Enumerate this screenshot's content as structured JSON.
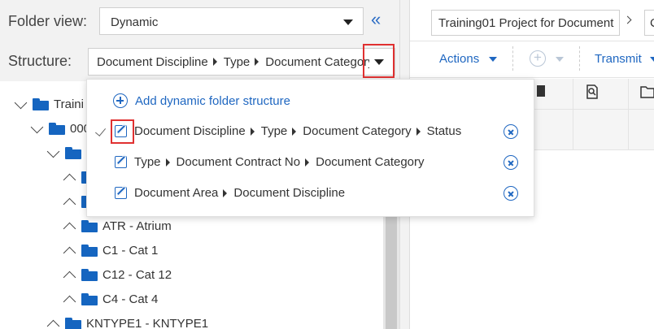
{
  "folder_view": {
    "label": "Folder view:",
    "value": "Dynamic"
  },
  "structure": {
    "label": "Structure:",
    "segments": [
      "Document Discipline",
      "Type",
      "Document Category"
    ]
  },
  "tree": {
    "items": [
      {
        "label": "Traini",
        "level": 0,
        "expanded": true
      },
      {
        "label": "000",
        "level": 1,
        "expanded": true
      },
      {
        "label": "",
        "level": 2,
        "expanded": true
      },
      {
        "label": "",
        "level": 3,
        "expanded": false
      },
      {
        "label": "",
        "level": 3,
        "expanded": false
      },
      {
        "label": "ATR - Atrium",
        "level": 3,
        "expanded": false
      },
      {
        "label": "C1 - Cat 1",
        "level": 3,
        "expanded": false
      },
      {
        "label": "C12 - Cat 12",
        "level": 3,
        "expanded": false
      },
      {
        "label": "C4 - Cat 4",
        "level": 3,
        "expanded": false
      },
      {
        "label": "KNTYPE1 - KNTYPE1",
        "level": 2,
        "expanded": false
      }
    ]
  },
  "popup": {
    "add_label": "Add dynamic folder structure",
    "options": [
      {
        "segments": [
          "Document Discipline",
          "Type",
          "Document Category",
          "Status"
        ],
        "selected": true
      },
      {
        "segments": [
          "Type",
          "Document Contract No",
          "Document Category"
        ],
        "selected": false
      },
      {
        "segments": [
          "Document Area",
          "Document Discipline"
        ],
        "selected": false
      }
    ]
  },
  "breadcrumb": {
    "project": "Training01 Project for Document",
    "next": "C"
  },
  "toolbar": {
    "actions_label": "Actions",
    "transmit_label": "Transmit"
  },
  "colors": {
    "accent": "#1f67c1",
    "folder": "#1565c0",
    "highlight": "#e03131",
    "panel_bg": "#f2f2f2"
  }
}
